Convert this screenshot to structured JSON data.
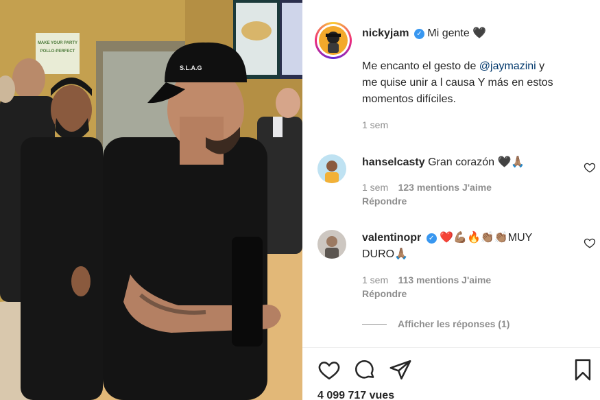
{
  "post": {
    "author": "nickyjam",
    "caption_first": "Mi gente",
    "caption_heart": "🖤",
    "caption_pre_mention": "Me encanto el gesto de ",
    "caption_mention": "@jaymazini",
    "caption_post_mention": " y",
    "caption_line2": "me quise unir a l causa Y más en estos",
    "caption_line3": "momentos difíciles.",
    "time": "1 sem",
    "video_cap_text": "S.L.A.G",
    "store_sign_line1": "MAKE YOUR PARTY",
    "store_sign_line2": "POLLO-PERFECT"
  },
  "comments": [
    {
      "username": "hanselcasty",
      "text": "Gran corazón 🖤🙏🏽",
      "time": "1 sem",
      "likes": "123 mentions J'aime",
      "reply_label": "Répondre",
      "avatar_color": "#f2b138"
    },
    {
      "username": "valentinopr",
      "verified": true,
      "text": "❤️💪🏽🔥👏🏽👏🏽MUY",
      "text_line2": "DURO🙏🏽",
      "time": "1 sem",
      "likes": "113 mentions J'aime",
      "reply_label": "Répondre",
      "avatar_color": "#c9c2bb"
    }
  ],
  "view_replies_label": "Afficher les réponses (1)",
  "actions": {
    "like_icon": "heart-icon",
    "comment_icon": "comment-icon",
    "share_icon": "paper-plane-icon",
    "save_icon": "bookmark-icon"
  },
  "views": "4 099 717 vues",
  "colors": {
    "verified": "#3897f0",
    "text": "#262626",
    "muted": "#8e8e8e",
    "mention": "#00376b"
  }
}
